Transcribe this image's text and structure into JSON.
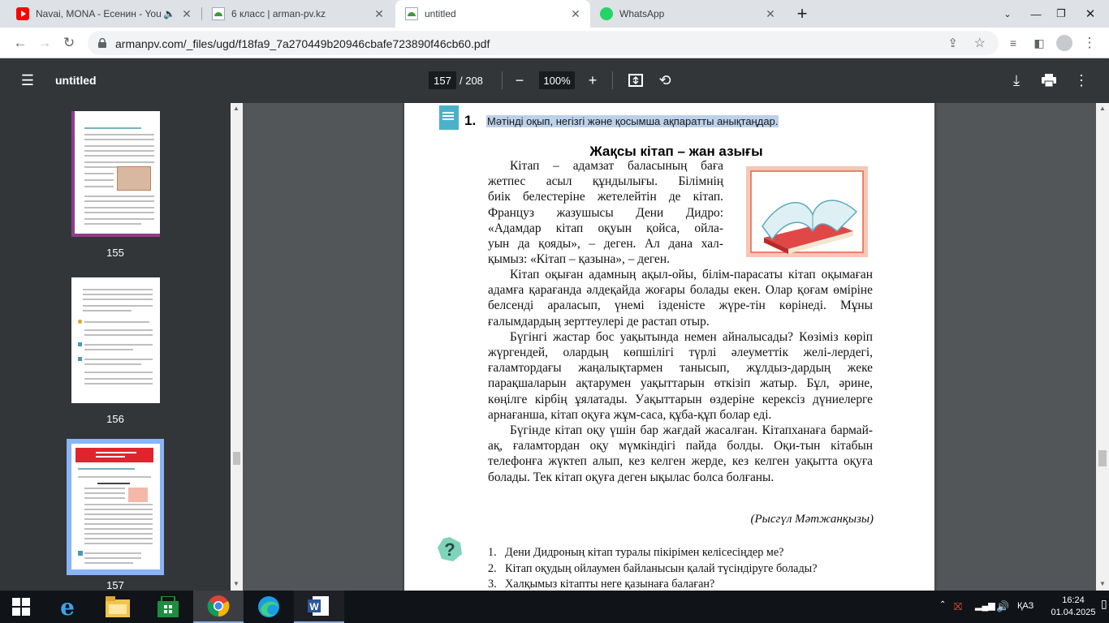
{
  "browser": {
    "tabs": [
      {
        "title": "Navai, MONA - Есенин - You",
        "icon": "youtube-icon",
        "active": false
      },
      {
        "title": "6 класс | arman-pv.kz",
        "icon": "arman-icon",
        "active": false
      },
      {
        "title": "untitled",
        "icon": "arman-icon",
        "active": true
      },
      {
        "title": "WhatsApp",
        "icon": "whatsapp-icon",
        "active": false
      }
    ],
    "url": "armanpv.com/_files/ugd/f18fa9_7a270449b20946cbafe723890f46cb60.pdf"
  },
  "pdf_toolbar": {
    "title": "untitled",
    "current_page": "157",
    "total_pages": "/ 208",
    "zoom": "100%"
  },
  "sidebar": {
    "thumbnails": [
      {
        "page": "155"
      },
      {
        "page": "156"
      },
      {
        "page": "157",
        "selected": true
      }
    ]
  },
  "page": {
    "task_number": "1.",
    "task_text": "Мәтінді оқып, негізгі және қосымша ақпаратты анықтаңдар.",
    "title": "Жақсы кітап – жан азығы",
    "para1_lines": [
      "Кітап – адамзат баласының баға",
      "жетпес асыл құндылығы. Білімнің",
      "биік белестеріне жетелейтін де кітап.",
      "Француз жазушысы Дени Дидро:",
      "«Адамдар кітап оқуын қойса, ойла-",
      "уын да қояды», – деген. Ал дана хал-",
      "қымыз: «Кітап – қазына», – деген."
    ],
    "paragraphs": [
      "Кітап оқыған адамның ақыл-ойы, білім-парасаты кітап оқымаған адамға қарағанда әлдеқайда жоғары болады екен. Олар қоғам өміріне белсенді араласып, үнемі ізденісте жүре-тін көрінеді. Мұны ғалымдардың зерттеулері де растап отыр.",
      "Бүгінгі жастар бос уақытында немен айналысады? Көзіміз көріп жүргендей, олардың көпшілігі түрлі әлеуметтік желі-лердегі, ғаламтордағы жаңалықтармен танысып, жұлдыз-дардың жеке парақшаларын ақтарумен уақыттарын өткізіп жатыр. Бұл, әрине, көңілге кірбің ұялатады. Уақыттарын өздеріне керексіз дүниелерге арнағанша, кітап оқуға жұм-саса, құба-құп болар еді.",
      "Бүгінде кітап оқу үшін бар жағдай жасалған. Кітапханаға бармай-ақ, ғаламтордан оқу мүмкіндігі пайда болды. Оқи-тын кітабын телефонға жүктеп алып, кез келген жерде, кез келген уақытта оқуға болады. Тек кітап оқуға деген ықылас болса болғаны."
    ],
    "author": "(Рысгүл Мәтжанқызы)",
    "questions": [
      {
        "num": "1.",
        "text": "Дени Дидроның кітап туралы пікірімен келісесіңдер ме?"
      },
      {
        "num": "2.",
        "text": "Кітап оқудың ойлаумен байланысын қалай түсіндіруге болады?"
      },
      {
        "num": "3.",
        "text": "Халқымыз кітапты неге қазынаға балаған?"
      }
    ]
  },
  "taskbar": {
    "apps": [
      "ie-icon",
      "file-explorer-icon",
      "store-icon",
      "chrome-icon",
      "edge-icon",
      "word-icon"
    ],
    "language": "ҚАЗ",
    "time": "16:24",
    "date": "01.04.2025"
  },
  "colors": {
    "pdf_toolbar": "#323639",
    "viewer_bg": "#525659",
    "selection": "#bcd1ea",
    "task_icon": "#4ab2c8",
    "thumb_selected": "#8ab4f8"
  }
}
